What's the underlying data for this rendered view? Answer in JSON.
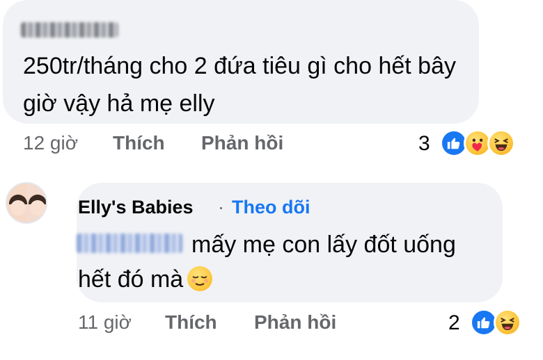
{
  "comment1": {
    "text": "250tr/tháng cho 2 đứa tiêu gì cho hết bây giờ vậy  hả mẹ elly",
    "time": "12 giờ",
    "like_label": "Thích",
    "reply_label": "Phản hồi",
    "reaction_count": "3",
    "reactions": [
      "like-icon",
      "care-icon",
      "haha-icon"
    ]
  },
  "comment2": {
    "author": "Elly's Babies",
    "separator": "·",
    "follow_label": "Theo dõi",
    "text_line1": "mấy mẹ con lấy đốt uống",
    "text_line2": "hết đó mà",
    "emoji": "relieved-face-icon",
    "time": "11 giờ",
    "like_label": "Thích",
    "reply_label": "Phản hồi",
    "reaction_count": "2",
    "reactions": [
      "like-icon",
      "haha-icon"
    ]
  },
  "colors": {
    "bubble": "#f0f2f5",
    "meta_text": "#65676b",
    "link_blue": "#1877f2",
    "like_blue": "#1877f2",
    "emoji_yellow": "#fcc43a"
  }
}
